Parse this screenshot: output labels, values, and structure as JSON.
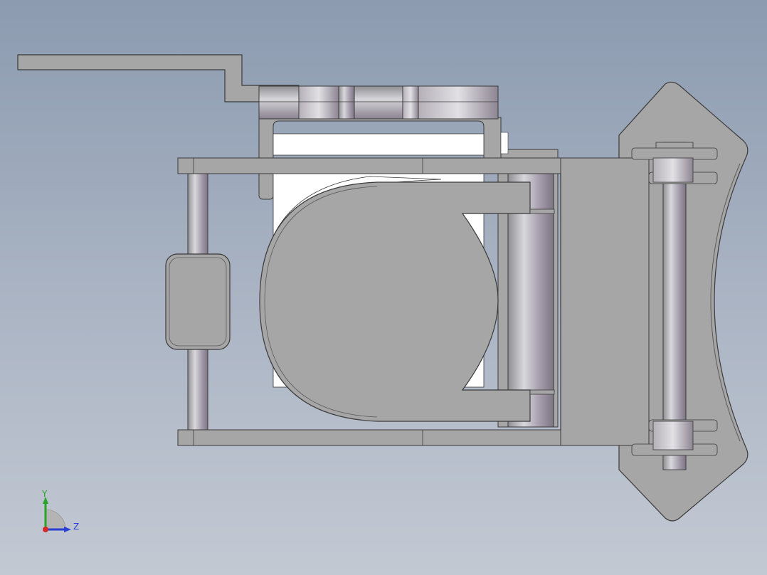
{
  "viewport": {
    "background_top": "#8c9bb0",
    "background_bottom": "#c3c9d3",
    "model_fill": "#a6a6a6",
    "model_edge": "#3a3a3a",
    "highlight_fill": "#ffffff",
    "accent_shade": "#9a8fa0"
  },
  "triad": {
    "y_label": "Y",
    "z_label": "Z",
    "y_color": "#2aa52a",
    "z_color": "#2a3fd6",
    "x_color": "#d62a2a"
  }
}
